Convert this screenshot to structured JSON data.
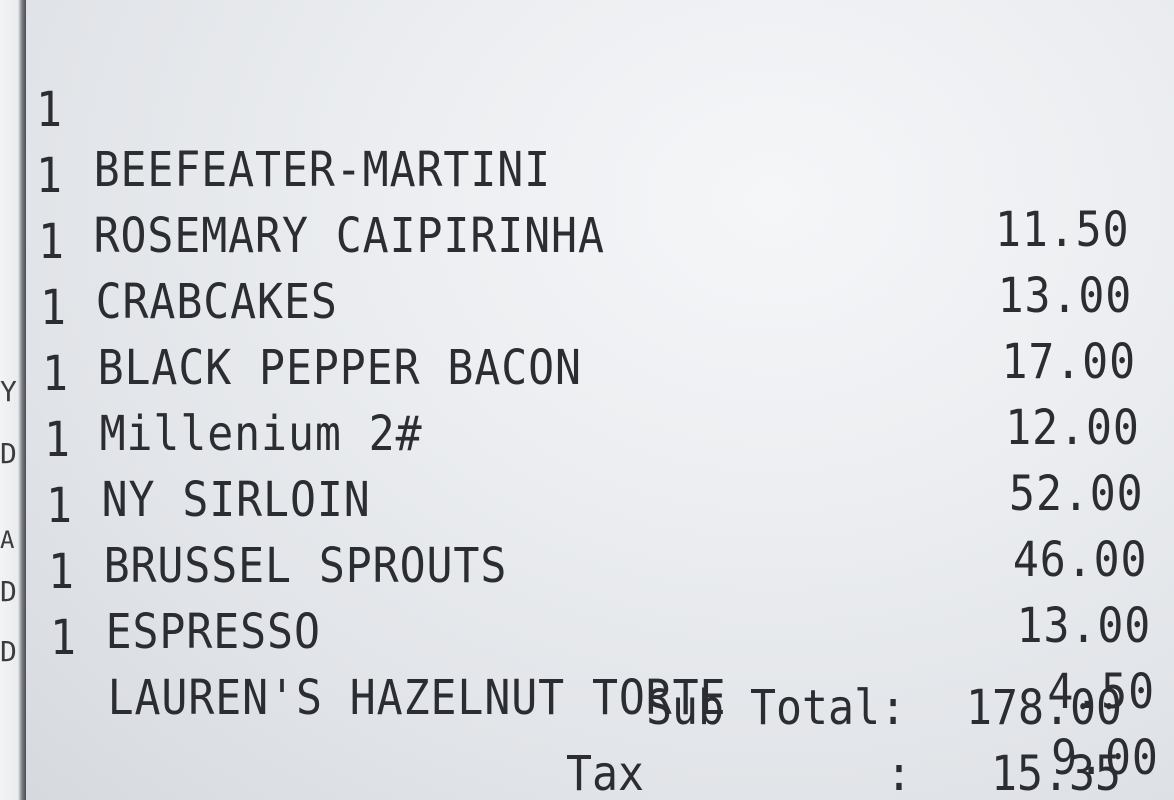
{
  "receipt": {
    "items": [
      {
        "qty": "1",
        "name": "BEEFEATER-MARTINI",
        "price": "11.50"
      },
      {
        "qty": "1",
        "name": "ROSEMARY CAIPIRINHA",
        "price": "13.00"
      },
      {
        "qty": "1",
        "name": "CRABCAKES",
        "price": "17.00"
      },
      {
        "qty": "1",
        "name": "BLACK PEPPER BACON",
        "price": "12.00"
      },
      {
        "qty": "1",
        "name": "Millenium 2#",
        "price": "52.00"
      },
      {
        "qty": "1",
        "name": "NY SIRLOIN",
        "price": "46.00"
      },
      {
        "qty": "1",
        "name": "BRUSSEL SPROUTS",
        "price": "13.00"
      },
      {
        "qty": "1",
        "name": "ESPRESSO",
        "price": "4.50"
      },
      {
        "qty": "1",
        "name": "LAUREN'S HAZELNUT TORTE",
        "price": "9.00"
      }
    ],
    "subtotal_label": "Sub Total:",
    "subtotal_value": "178.00",
    "tax_label": "Tax",
    "tax_colon": ":",
    "tax_value": "15.35"
  },
  "edge": {
    "letters": [
      "Y",
      "D",
      "A",
      "D",
      "D"
    ]
  },
  "colors": {
    "ink": "#2b2d33",
    "paper": "#eceef1"
  }
}
